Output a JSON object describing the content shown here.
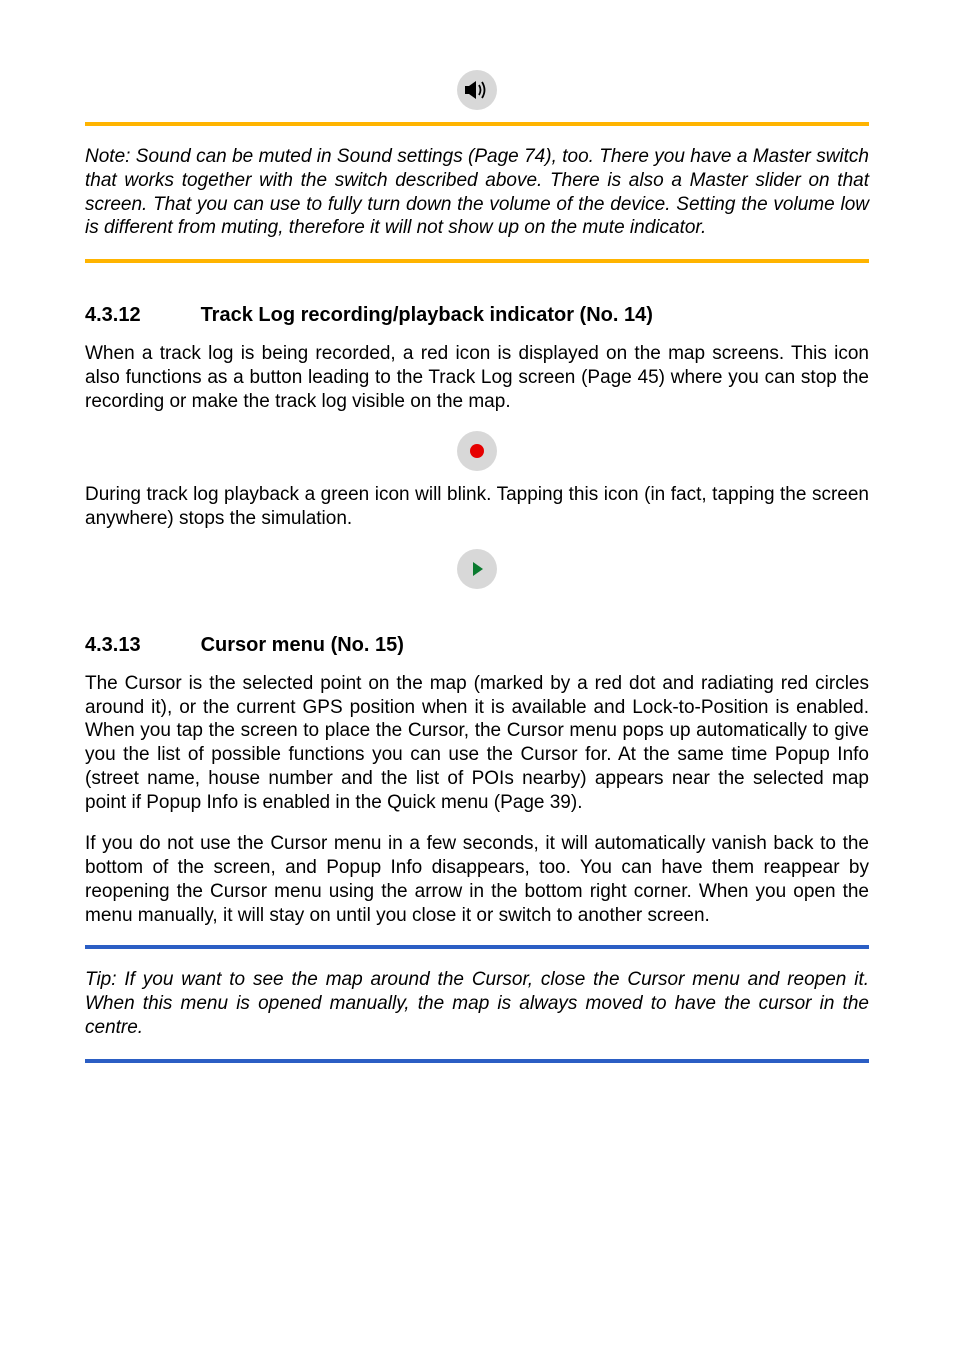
{
  "icons": {
    "speaker": "speaker-icon",
    "recordDot": "record-dot-icon",
    "playTriangle": "play-triangle-icon"
  },
  "note": {
    "text": "Note: Sound can be muted in Sound settings (Page 74), too. There you have a Master switch that works together with the switch described above. There is also a Master slider on that screen. That you can use to fully turn down the volume of the device. Setting the volume low is different from muting, therefore it will not show up on the mute indicator."
  },
  "section1": {
    "number": "4.3.12",
    "title": "Track Log recording/playback indicator (No. 14)",
    "para1": "When a track log is being recorded, a red icon is displayed on the map screens. This icon also functions as a button leading to the Track Log screen (Page 45) where you can stop the recording or make the track log visible on the map.",
    "para2": "During track log playback a green icon will blink. Tapping this icon (in fact, tapping the screen anywhere) stops the simulation."
  },
  "section2": {
    "number": "4.3.13",
    "title": "Cursor menu (No. 15)",
    "para1": "The Cursor is the selected point on the map (marked by a red dot and radiating red circles around it), or the current GPS position when it is available and Lock-to-Position is enabled. When you tap the screen to place the Cursor, the Cursor menu pops up automatically to give you the list of possible functions you can use the Cursor for. At the same time Popup Info (street name, house number and the list of POIs nearby) appears near the selected map point if Popup Info is enabled in the Quick menu (Page 39).",
    "para2": "If you do not use the Cursor menu in a few seconds, it will automatically vanish back to the bottom of the screen, and Popup Info disappears, too. You can have them reappear by reopening the Cursor menu using the arrow in the bottom right corner. When you open the menu manually, it will stay on until you close it or switch to another screen."
  },
  "tip": {
    "text": "Tip: If you want to see the map around the Cursor, close the Cursor menu and reopen it. When this menu is opened manually, the map is always moved to have the cursor in the centre."
  }
}
